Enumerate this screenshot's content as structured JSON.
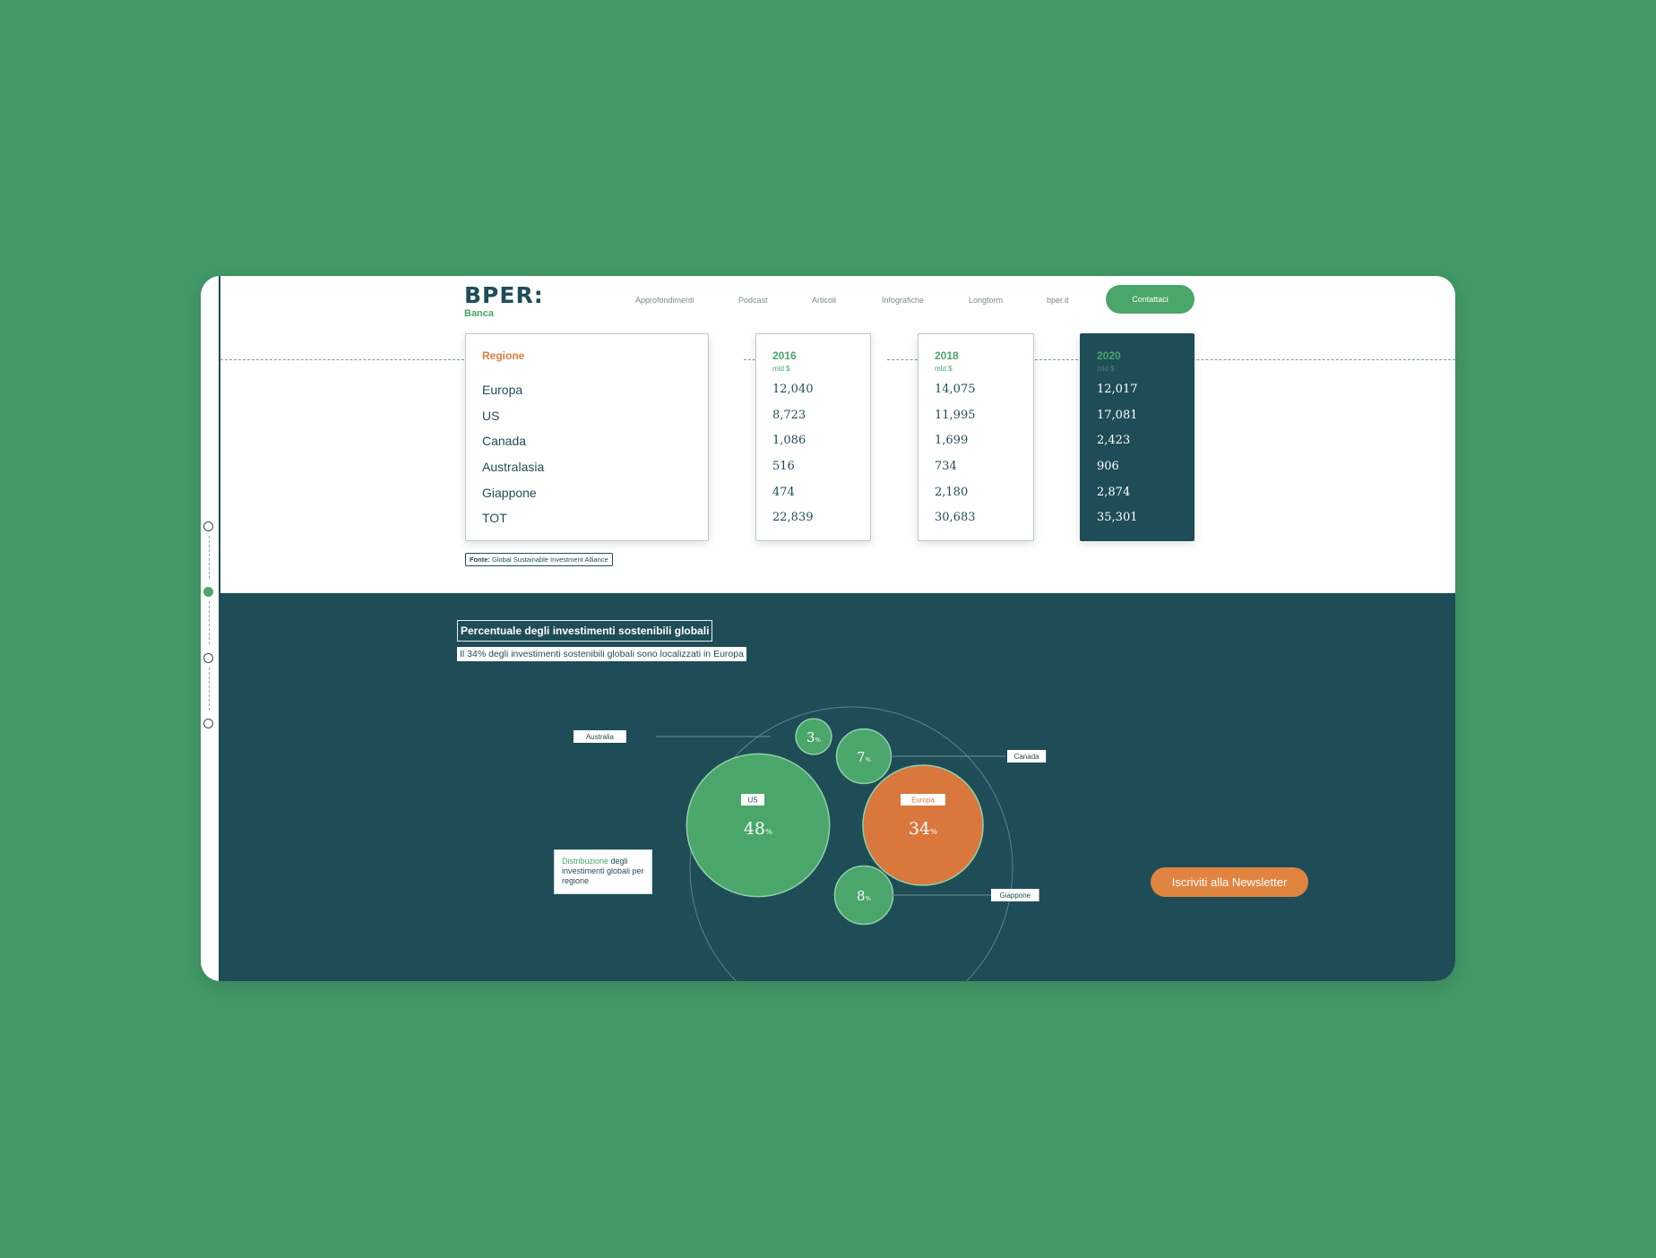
{
  "logo": {
    "main": "BPER:",
    "sub": "Banca"
  },
  "nav": {
    "items": [
      "Approfondimenti",
      "Podcast",
      "Articoli",
      "Infografiche",
      "Longform",
      "bper.it"
    ],
    "contact": "Contattaci"
  },
  "table": {
    "region_title": "Regione",
    "regions": [
      "Europa",
      "US",
      "Canada",
      "Australasia",
      "Giappone",
      "TOT"
    ],
    "unit": "mld $",
    "years": [
      {
        "year": "2016",
        "values": [
          "12,040",
          "8,723",
          "1,086",
          "516",
          "474",
          "22,839"
        ]
      },
      {
        "year": "2018",
        "values": [
          "14,075",
          "11,995",
          "1,699",
          "734",
          "2,180",
          "30,683"
        ]
      },
      {
        "year": "2020",
        "values": [
          "12,017",
          "17,081",
          "2,423",
          "906",
          "2,874",
          "35,301"
        ]
      }
    ],
    "source_label": "Fonte:",
    "source_text": "Global Sustainable Investment Alliance"
  },
  "section": {
    "title": "Percentuale degli investimenti sostenibili globali",
    "subtitle": "Il 34% degli investimenti sostenibili globali sono localizzati in Europa"
  },
  "legend": {
    "highlight": "Distribuzione",
    "rest": " degli investimenti globali per regione"
  },
  "chart_data": {
    "type": "bubble",
    "unit": "%",
    "series": [
      {
        "label": "US",
        "value": 48,
        "color": "#4aa66a"
      },
      {
        "label": "Europa",
        "value": 34,
        "color": "#d9773c"
      },
      {
        "label": "Giappone",
        "value": 8,
        "color": "#4aa66a"
      },
      {
        "label": "Canada",
        "value": 7,
        "color": "#4aa66a"
      },
      {
        "label": "Australia",
        "value": 3,
        "color": "#4aa66a"
      }
    ]
  },
  "newsletter": "Iscriviti alla Newsletter",
  "colors": {
    "background": "#439a68",
    "dark": "#1f4d57",
    "accent": "#4aa66a",
    "orange": "#e07b3a"
  }
}
